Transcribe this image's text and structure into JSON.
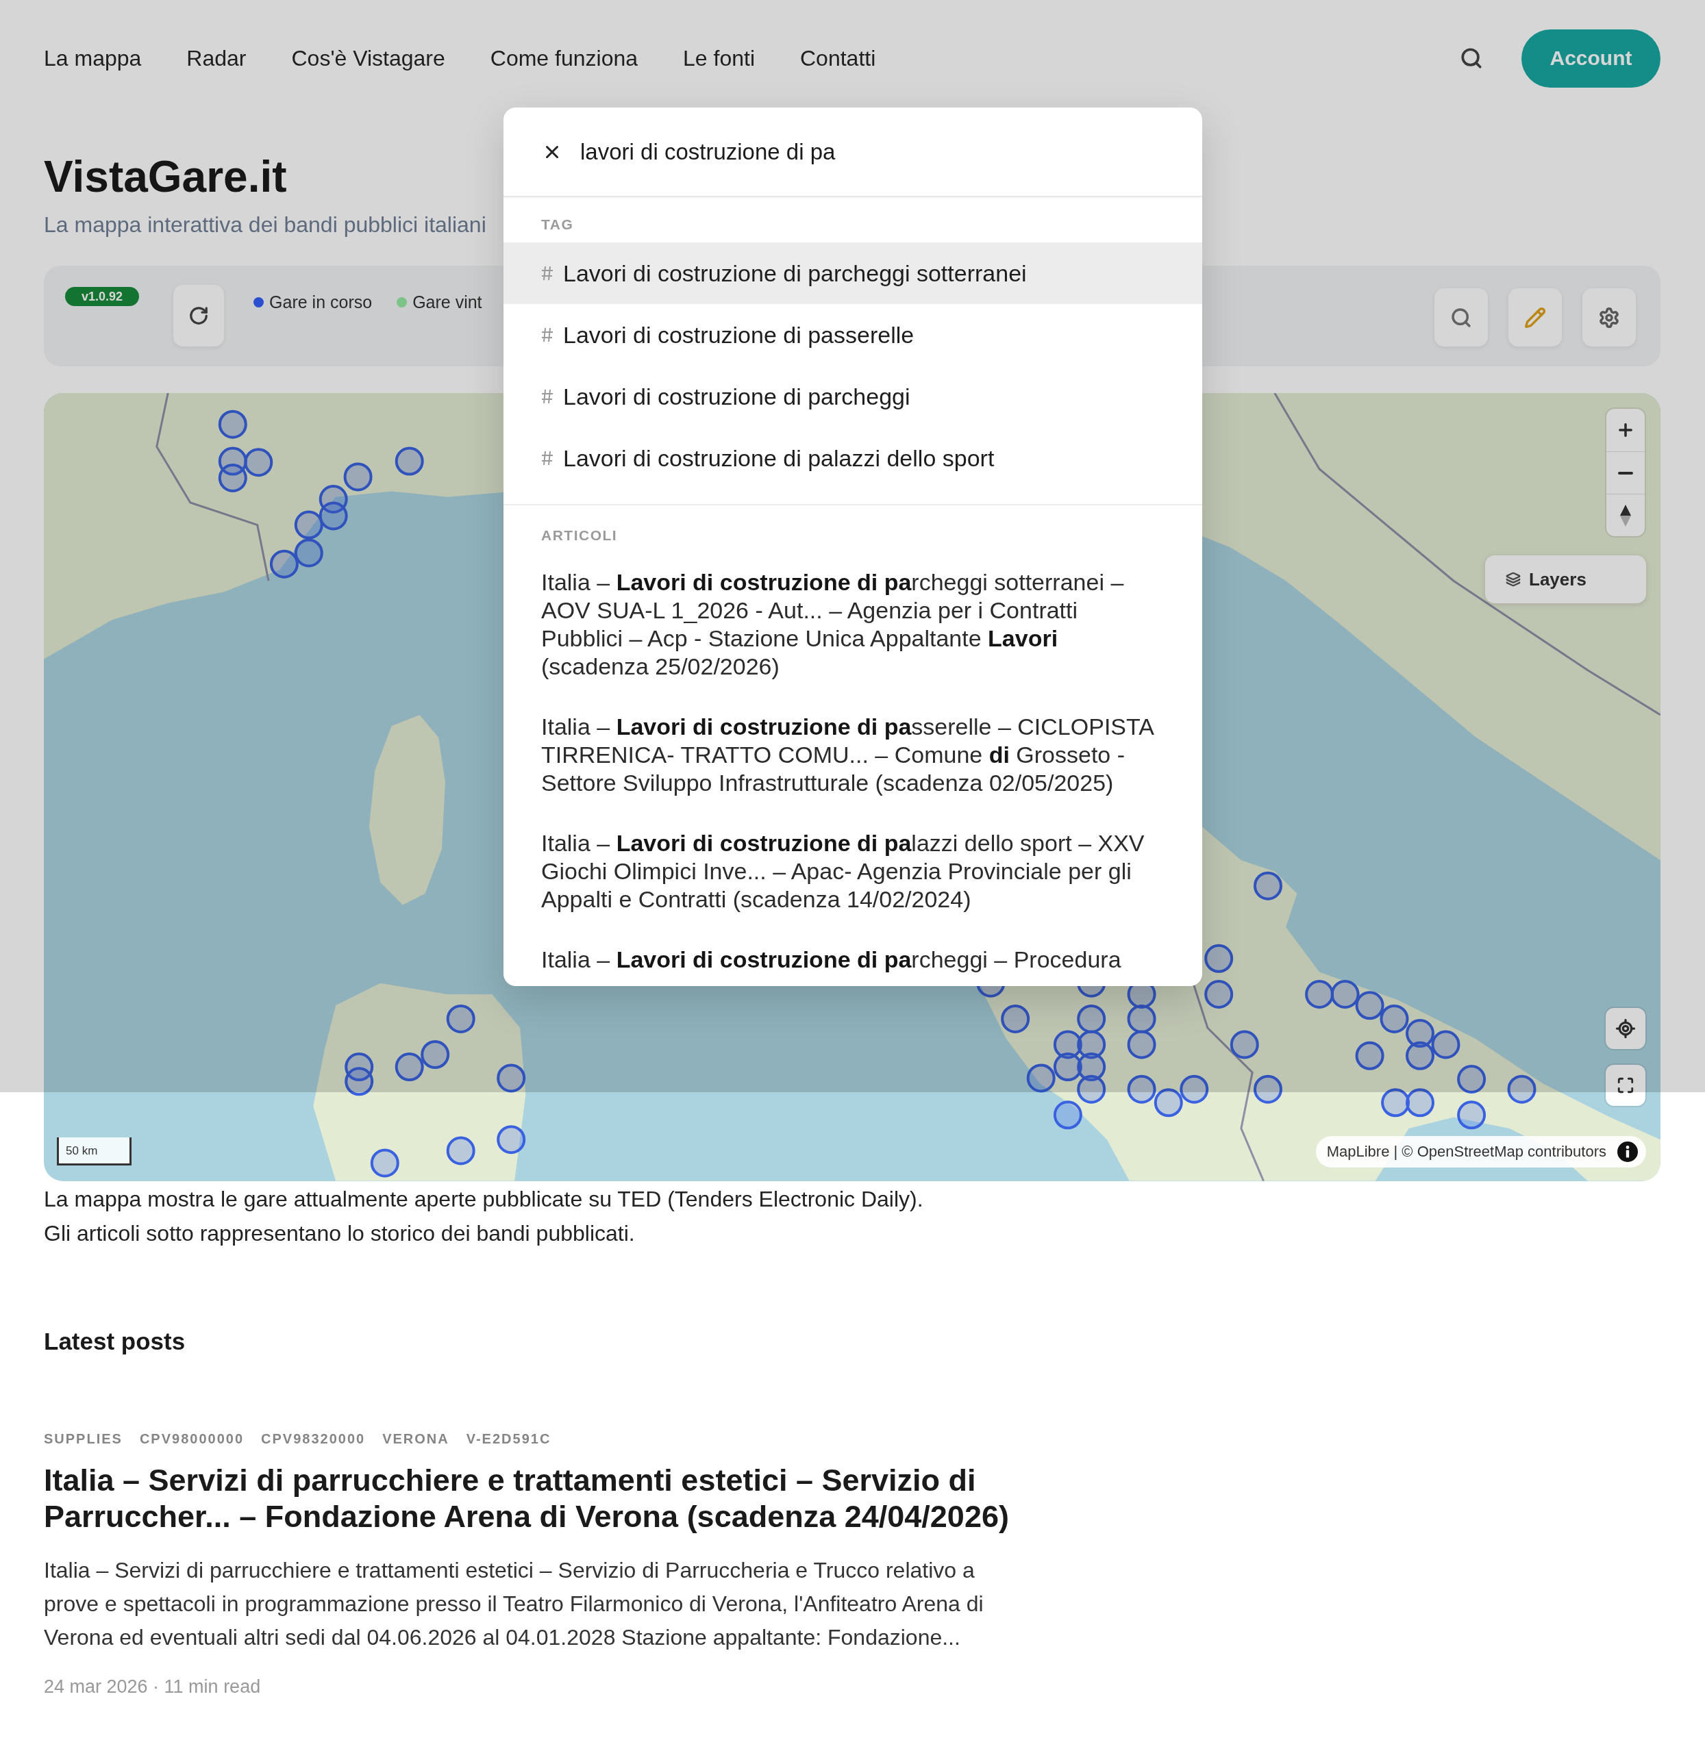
{
  "nav": {
    "links": [
      {
        "label": "La mappa"
      },
      {
        "label": "Radar"
      },
      {
        "label": "Cos'è Vistagare"
      },
      {
        "label": "Come funziona"
      },
      {
        "label": "Le fonti"
      },
      {
        "label": "Contatti"
      }
    ],
    "account_button": "Account"
  },
  "hero": {
    "title": "VistaGare.it",
    "subtitle": "La mappa interattiva dei bandi pubblici italiani"
  },
  "toolbar": {
    "version": "v1.0.92",
    "legend": [
      {
        "label": "Gare in corso",
        "color": "#2b50d2"
      },
      {
        "label": "Gare vint",
        "color": "#7cc48a"
      }
    ]
  },
  "map": {
    "layers_button": "Layers",
    "scale": "50 km",
    "attribution": "MapLibre | © OpenStreetMap contributors"
  },
  "map_note": [
    "La mappa mostra le gare attualmente aperte pubblicate su TED (Tenders Electronic Daily).",
    "Gli articoli sotto rappresentano lo storico dei bandi pubblicati."
  ],
  "search": {
    "value": "lavori di costruzione di pa",
    "tags": {
      "heading": "TAG",
      "items": [
        {
          "label": "Lavori di costruzione di parcheggi sotterranei",
          "selected": true
        },
        {
          "label": "Lavori di costruzione di passerelle",
          "selected": false
        },
        {
          "label": "Lavori di costruzione di parcheggi",
          "selected": false
        },
        {
          "label": "Lavori di costruzione di palazzi dello sport",
          "selected": false
        }
      ]
    },
    "articles": {
      "heading": "ARTICOLI",
      "items": [
        {
          "title": "Italia – **Lavori di costruzione di pa**rcheggi sotterranei – AOV SUA-L 1_2026 - Aut... – Agenzia per i Contratti Pubblici – Acp - Stazione Unica Appaltante **Lavori** (scadenza 25/02/2026)"
        },
        {
          "title": "Italia – **Lavori di costruzione di pa**sserelle – CICLOPISTA TIRRENICA- TRATTO COMU... – Comune **di** Grosseto - Settore Sviluppo Infrastrutturale (scadenza 02/05/2025)"
        },
        {
          "title": "Italia – **Lavori di costruzione di pa**lazzi dello sport – XXV Giochi Olimpici Inve... – Apac- Agenzia Provinciale per gli Appalti e Contratti (scadenza 14/02/2024)"
        },
        {
          "title": "Italia – **Lavori di costruzione di pa**rcheggi – Procedura"
        }
      ]
    }
  },
  "latest_posts": {
    "heading": "Latest posts",
    "posts": [
      {
        "tags": [
          "SUPPLIES",
          "CPV98000000",
          "CPV98320000",
          "VERONA",
          "V-E2D591C"
        ],
        "title": "Italia – Servizi di parrucchiere e trattamenti estetici – Servizio di Parruccher... – Fondazione Arena di Verona (scadenza 24/04/2026)",
        "excerpt": "Italia – Servizi di parrucchiere e trattamenti estetici – Servizio di Parruccheria e Trucco relativo a prove e spettacoli in programmazione presso il Teatro Filarmonico di Verona, l'Anfiteatro Arena di Verona ed eventuali altri sedi dal 04.06.2026 al 04.01.2028 Stazione appaltante: Fondazione...",
        "meta": "24 mar 2026 · 11 min read"
      }
    ]
  }
}
